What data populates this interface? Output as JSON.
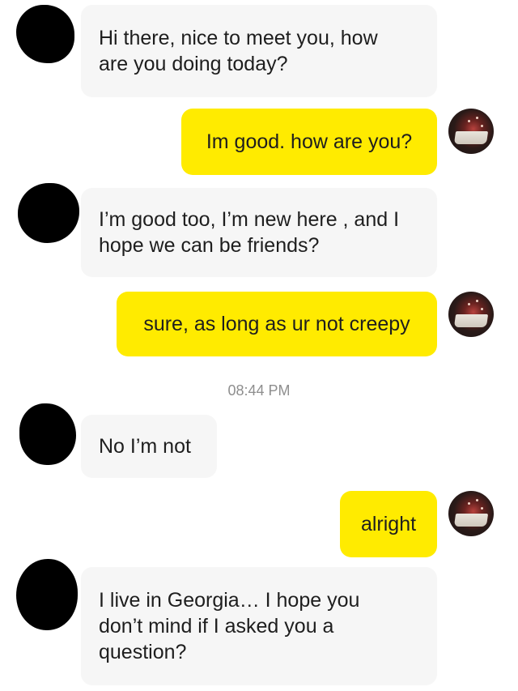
{
  "conversation": {
    "messages": [
      {
        "sender": "other",
        "text": "Hi there, nice to meet you, how\nare you doing today?"
      },
      {
        "sender": "me",
        "text": "Im good. how are you?"
      },
      {
        "sender": "other",
        "text": "I’m good too, I’m new here , and I\nhope we can be friends?"
      },
      {
        "sender": "me",
        "text": "sure, as long as ur not creepy"
      },
      {
        "sender": "other",
        "text": "No I’m not"
      },
      {
        "sender": "me",
        "text": "alright"
      },
      {
        "sender": "other",
        "text": "I live in Georgia… I hope you\ndon’t mind if I asked you a\nquestion?"
      }
    ],
    "timestamp": "08:44 PM"
  },
  "colors": {
    "outgoing_bubble": "#ffeb00",
    "incoming_bubble": "#f6f6f6",
    "timestamp_text": "#8e8e8e"
  },
  "icons": {
    "other_avatar": "redacted-avatar-icon",
    "my_avatar": "profile-photo-avatar"
  }
}
